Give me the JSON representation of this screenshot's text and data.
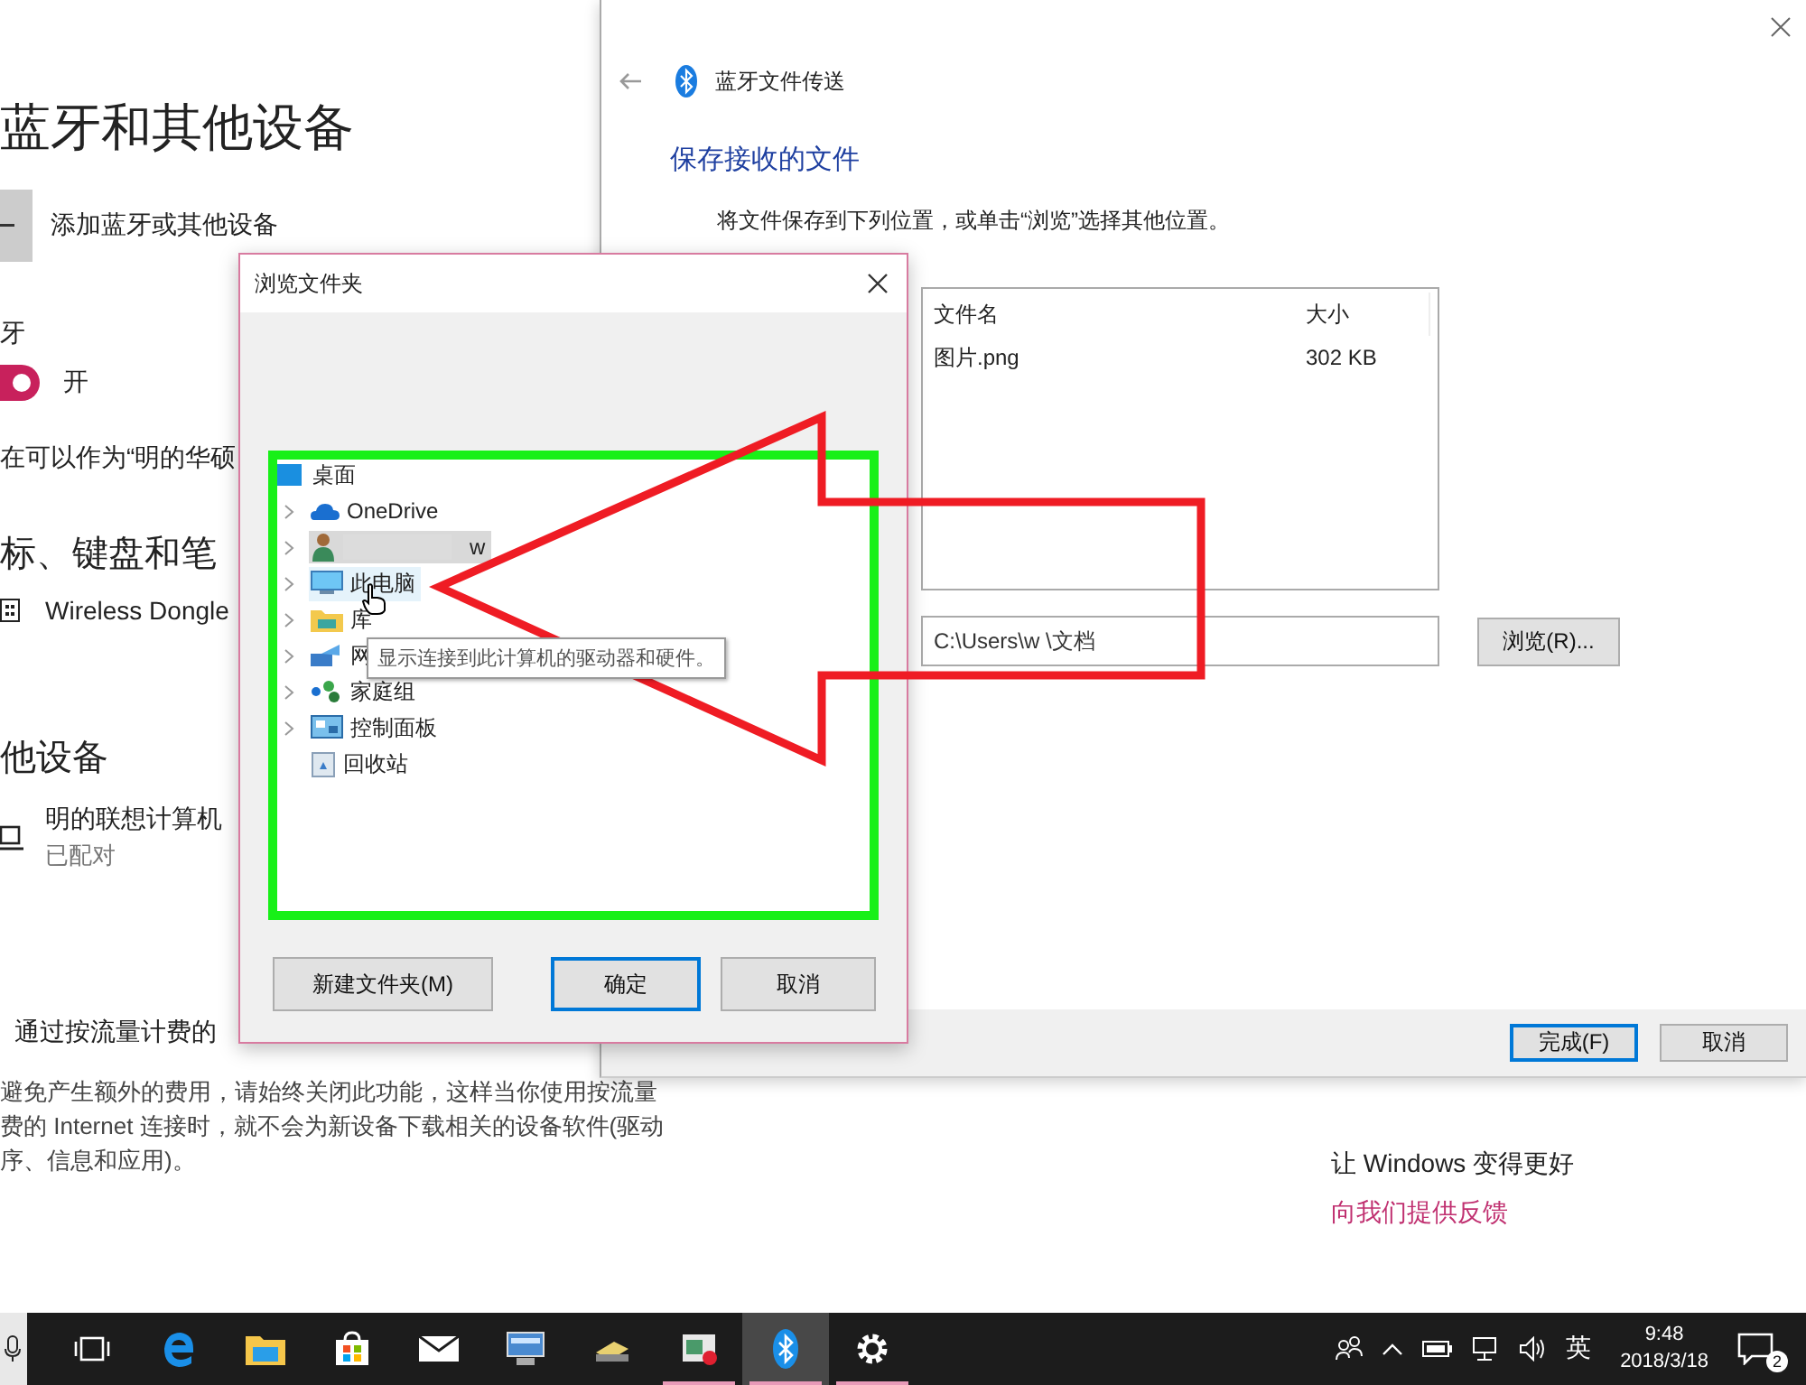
{
  "settings": {
    "title": "蓝牙和其他设备",
    "add_device": "添加蓝牙或其他设备",
    "bluetooth_label": "牙",
    "bluetooth_toggle": {
      "on": true,
      "label": "开"
    },
    "discoverable_note": "在可以作为“明的华硕",
    "section_input": "标、键盘和笔",
    "input_devices": [
      {
        "name": "Wireless Dongle"
      }
    ],
    "section_other": "他设备",
    "other_devices": [
      {
        "name": "明的联想计算机",
        "status": "已配对"
      }
    ],
    "metered_label": "通过按流量计费的",
    "metered_note": [
      "避免产生额外的费用，请始终关闭此功能，这样当你使用按流量",
      "费的 Internet 连接时，就不会为新设备下载相关的设备软件(驱动",
      "序、信息和应用)。"
    ],
    "feedback_title": "让 Windows 变得更好",
    "feedback_link": "向我们提供反馈"
  },
  "transfer_window": {
    "title": "蓝牙文件传送",
    "heading": "保存接收的文件",
    "instruction": "将文件保存到下列位置，或单击“浏览”选择其他位置。",
    "columns": [
      "文件名",
      "大小"
    ],
    "files": [
      {
        "name": "图片.png",
        "size": "302 KB"
      }
    ],
    "path": "C:\\Users\\w \\文档",
    "browse_button": "浏览(R)...",
    "buttons": [
      {
        "label": "完成(F)",
        "default": true
      },
      {
        "label": "取消",
        "default": false
      }
    ]
  },
  "browse_dialog": {
    "title": "浏览文件夹",
    "tree": [
      {
        "label": "桌面",
        "kind": "desktop",
        "expandable": false,
        "selected": false,
        "hover": false,
        "children": [
          {
            "label": "OneDrive",
            "kind": "cloud",
            "expandable": true,
            "selected": false,
            "hover": false
          },
          {
            "label": "w",
            "kind": "user",
            "expandable": true,
            "selected": true,
            "hover": false
          },
          {
            "label": "此电脑",
            "kind": "computer",
            "expandable": true,
            "selected": false,
            "hover": true
          },
          {
            "label": "库",
            "kind": "library",
            "expandable": true,
            "selected": false,
            "hover": false
          },
          {
            "label": "网",
            "kind": "network",
            "expandable": true,
            "selected": false,
            "hover": false
          },
          {
            "label": "家庭组",
            "kind": "homegroup",
            "expandable": true,
            "selected": false,
            "hover": false
          },
          {
            "label": "控制面板",
            "kind": "control-panel",
            "expandable": true,
            "selected": false,
            "hover": false
          },
          {
            "label": "回收站",
            "kind": "recycle-bin",
            "expandable": false,
            "selected": false,
            "hover": false
          }
        ]
      }
    ],
    "tooltip": "显示连接到此计算机的驱动器和硬件。",
    "buttons": [
      {
        "label": "新建文件夹(M)",
        "default": false
      },
      {
        "label": "确定",
        "default": true
      },
      {
        "label": "取消",
        "default": false
      }
    ]
  },
  "taskbar": {
    "apps": [
      {
        "running": false,
        "active": false
      },
      {
        "running": false,
        "active": false
      },
      {
        "running": false,
        "active": false
      },
      {
        "running": false,
        "active": false
      },
      {
        "running": false,
        "active": false
      },
      {
        "running": false,
        "active": false
      },
      {
        "running": false,
        "active": false
      },
      {
        "running": false,
        "active": false
      },
      {
        "running": true,
        "active": false
      },
      {
        "running": true,
        "active": true
      },
      {
        "running": true,
        "active": false
      }
    ],
    "ime": "英",
    "time": "9:48",
    "date": "2018/3/18",
    "notifications": "2"
  }
}
